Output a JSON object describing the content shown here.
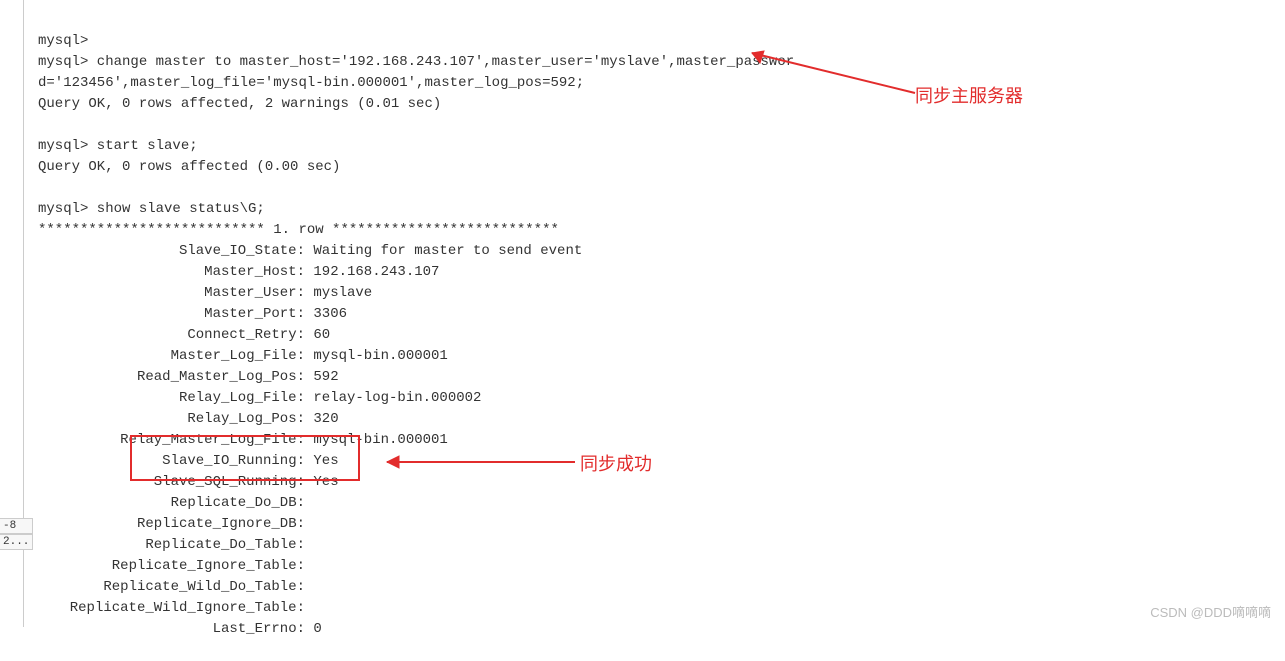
{
  "terminal": {
    "line1": "mysql>",
    "line2": "mysql> change master to master_host='192.168.243.107',master_user='myslave',master_passwor",
    "line3": "d='123456',master_log_file='mysql-bin.000001',master_log_pos=592;",
    "line4": "Query OK, 0 rows affected, 2 warnings (0.01 sec)",
    "line5": "",
    "line6": "mysql> start slave;",
    "line7": "Query OK, 0 rows affected (0.00 sec)",
    "line8": "",
    "line9": "mysql> show slave status\\G;",
    "line10": "*************************** 1. row ***************************",
    "status": [
      {
        "label": "Slave_IO_State:",
        "value": "Waiting for master to send event"
      },
      {
        "label": "Master_Host:",
        "value": "192.168.243.107"
      },
      {
        "label": "Master_User:",
        "value": "myslave"
      },
      {
        "label": "Master_Port:",
        "value": "3306"
      },
      {
        "label": "Connect_Retry:",
        "value": "60"
      },
      {
        "label": "Master_Log_File:",
        "value": "mysql-bin.000001"
      },
      {
        "label": "Read_Master_Log_Pos:",
        "value": "592"
      },
      {
        "label": "Relay_Log_File:",
        "value": "relay-log-bin.000002"
      },
      {
        "label": "Relay_Log_Pos:",
        "value": "320"
      },
      {
        "label": "Relay_Master_Log_File:",
        "value": "mysql-bin.000001"
      },
      {
        "label": "Slave_IO_Running:",
        "value": "Yes"
      },
      {
        "label": "Slave_SQL_Running:",
        "value": "Yes"
      },
      {
        "label": "Replicate_Do_DB:",
        "value": ""
      },
      {
        "label": "Replicate_Ignore_DB:",
        "value": ""
      },
      {
        "label": "Replicate_Do_Table:",
        "value": ""
      },
      {
        "label": "Replicate_Ignore_Table:",
        "value": ""
      },
      {
        "label": "Replicate_Wild_Do_Table:",
        "value": ""
      },
      {
        "label": "Replicate_Wild_Ignore_Table:",
        "value": ""
      },
      {
        "label": "Last_Errno:",
        "value": "0"
      }
    ]
  },
  "sidebar": {
    "tab1": "-8",
    "tab2": "2..."
  },
  "annotations": {
    "top": "同步主服务器",
    "bottom": "同步成功"
  },
  "watermark": "CSDN @DDD嘀嘀嘀"
}
